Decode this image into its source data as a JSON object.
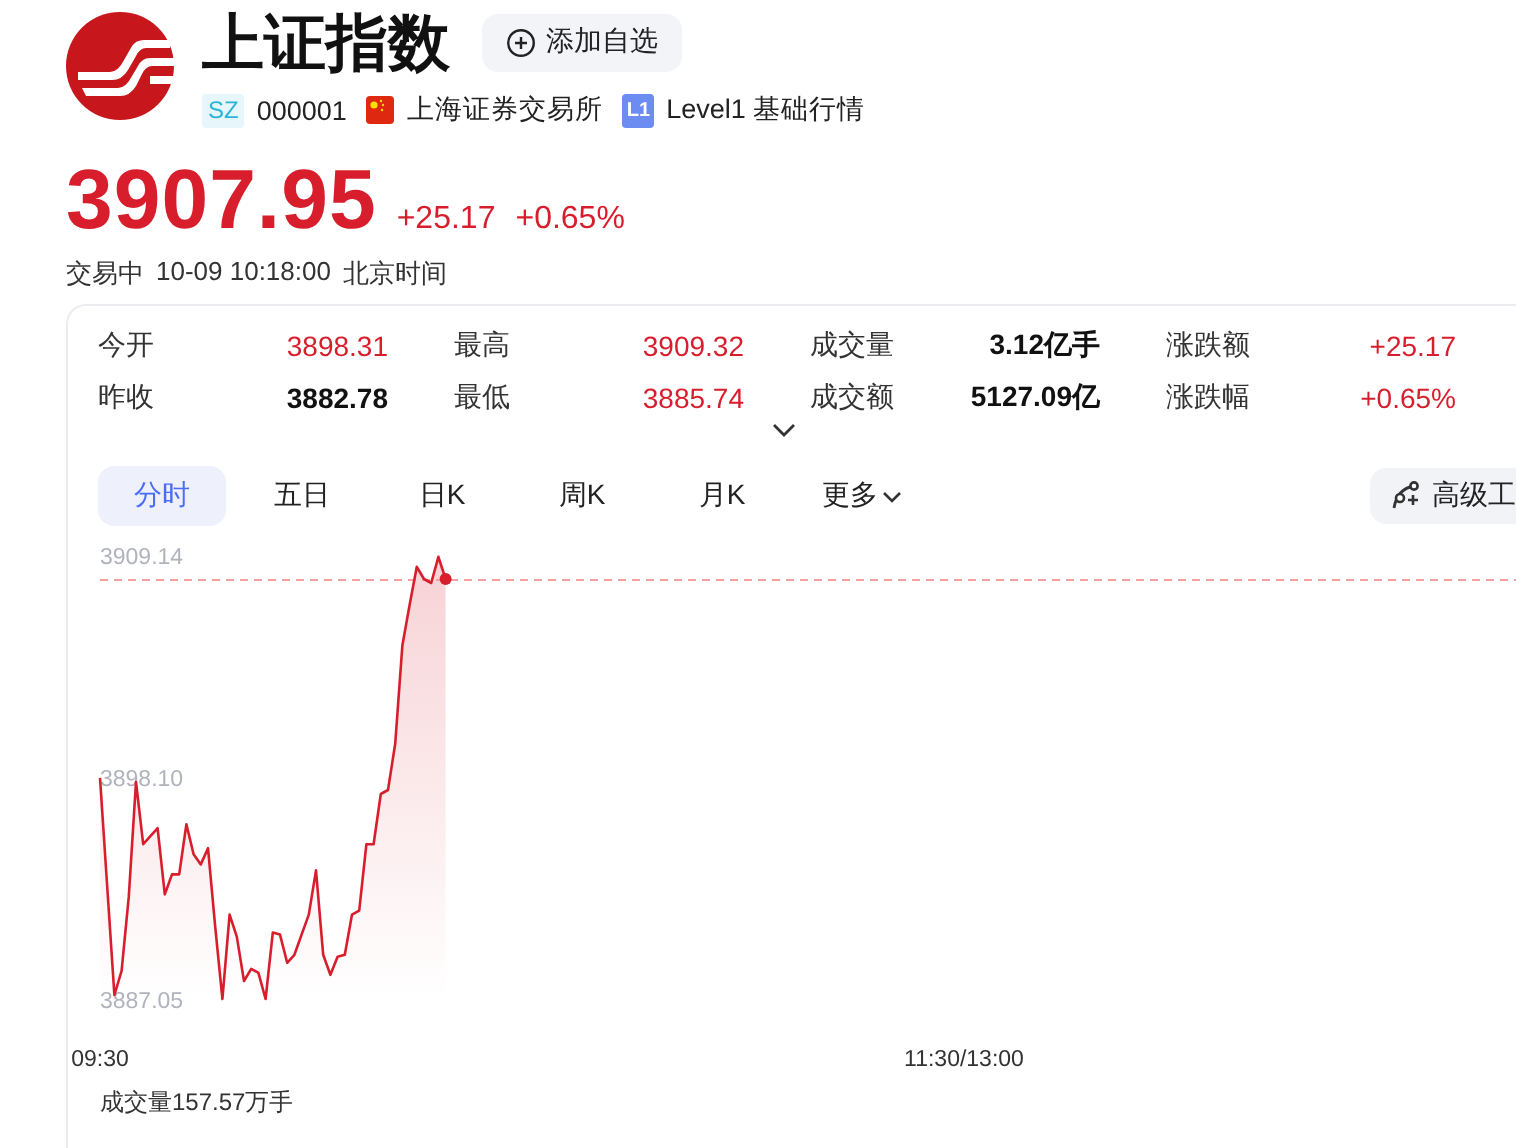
{
  "header": {
    "title": "上证指数",
    "watch_button": "添加自选",
    "market_badge": "SZ",
    "code": "000001",
    "exchange": "上海证券交易所",
    "level_badge": "L1",
    "level_text": "Level1 基础行情"
  },
  "quote": {
    "price": "3907.95",
    "change": "+25.17",
    "change_pct": "+0.65%",
    "status": "交易中",
    "time": "10-09 10:18:00",
    "timezone": "北京时间"
  },
  "stats": [
    {
      "label": "今开",
      "value": "3898.31",
      "color": "#d81e2c"
    },
    {
      "label": "最高",
      "value": "3909.32",
      "color": "#d81e2c"
    },
    {
      "label": "成交量",
      "value": "3.12亿手",
      "color": "#111111"
    },
    {
      "label": "涨跌额",
      "value": "+25.17",
      "color": "#d81e2c"
    },
    {
      "label": "昨收",
      "value": "3882.78",
      "color": "#111111"
    },
    {
      "label": "最低",
      "value": "3885.74",
      "color": "#d81e2c"
    },
    {
      "label": "成交额",
      "value": "5127.09亿",
      "color": "#111111"
    },
    {
      "label": "涨跌幅",
      "value": "+0.65%",
      "color": "#d81e2c"
    }
  ],
  "tabs": [
    {
      "label": "分时",
      "selected": true,
      "kind": "plain"
    },
    {
      "label": "五日",
      "selected": false,
      "kind": "plain"
    },
    {
      "label": "日K",
      "selected": false,
      "kind": "plain"
    },
    {
      "label": "周K",
      "selected": false,
      "kind": "plain"
    },
    {
      "label": "月K",
      "selected": false,
      "kind": "plain"
    },
    {
      "label": "更多",
      "selected": false,
      "kind": "menu"
    }
  ],
  "tools_button": "高级工",
  "chart": {
    "volume_label": "成交量157.57万手",
    "chart_data": {
      "type": "line",
      "ylim": [
        3887.05,
        3909.14
      ],
      "ref_lines": [
        {
          "axis": "y",
          "value": 3907.95,
          "color": "#f5a0a0"
        }
      ],
      "yticks": [
        {
          "value": 3909.14,
          "label": "3909.14"
        },
        {
          "value": 3898.1,
          "label": "3898.10"
        },
        {
          "value": 3887.05,
          "label": "3887.05"
        }
      ],
      "categories": [
        "09:30",
        null,
        null,
        null,
        null,
        null,
        null,
        null,
        null,
        null,
        null,
        null,
        null,
        null,
        null,
        null,
        null,
        null,
        null,
        null,
        null,
        null,
        null,
        null,
        null,
        null,
        null,
        null,
        null,
        null,
        null,
        null,
        null,
        null,
        null,
        null,
        null,
        null,
        null,
        null,
        null,
        null,
        null,
        null,
        null,
        null,
        null,
        null,
        null,
        null,
        null,
        null,
        null,
        null,
        null,
        null,
        null,
        null,
        null,
        null,
        null,
        null,
        null,
        null,
        null,
        null,
        null,
        null,
        null,
        null,
        null,
        null,
        null,
        null,
        null,
        null,
        null,
        null,
        null,
        null,
        null,
        null,
        null,
        null,
        null,
        null,
        null,
        null,
        null,
        null,
        null,
        null,
        null,
        null,
        null,
        null,
        null,
        null,
        null,
        null,
        null,
        null,
        null,
        null,
        null,
        null,
        null,
        null,
        null,
        null,
        null,
        null,
        null,
        null,
        null,
        null,
        null,
        null,
        null,
        null,
        "11:30/13:00"
      ],
      "series": [
        {
          "color": "#d81e2c",
          "values": [
            3898.1,
            3892.7,
            3887.3,
            3888.5,
            3892.2,
            3897.9,
            3894.8,
            3895.2,
            3895.6,
            3892.3,
            3893.3,
            3893.3,
            3895.8,
            3894.3,
            3893.8,
            3894.6,
            3890.7,
            3887.1,
            3891.3,
            3890.2,
            3888.0,
            3888.6,
            3888.4,
            3887.1,
            3890.4,
            3890.3,
            3888.9,
            3889.3,
            3890.3,
            3891.3,
            3893.5,
            3889.3,
            3888.3,
            3889.2,
            3889.3,
            3891.3,
            3891.5,
            3894.8,
            3894.8,
            3897.3,
            3897.5,
            3899.8,
            3904.7,
            3906.7,
            3908.6,
            3908.0,
            3907.8,
            3909.1,
            3908.0,
            null,
            null,
            null,
            null,
            null,
            null,
            null,
            null,
            null,
            null,
            null,
            null,
            null,
            null,
            null,
            null,
            null,
            null,
            null,
            null,
            null,
            null,
            null,
            null,
            null,
            null,
            null,
            null,
            null,
            null,
            null,
            null,
            null,
            null,
            null,
            null,
            null,
            null,
            null,
            null,
            null,
            null,
            null,
            null,
            null,
            null,
            null,
            null,
            null,
            null,
            null,
            null,
            null,
            null,
            null,
            null,
            null,
            null,
            null,
            null,
            null,
            null,
            null,
            null,
            null,
            null,
            null,
            null,
            null,
            null,
            null,
            null
          ]
        }
      ]
    }
  }
}
